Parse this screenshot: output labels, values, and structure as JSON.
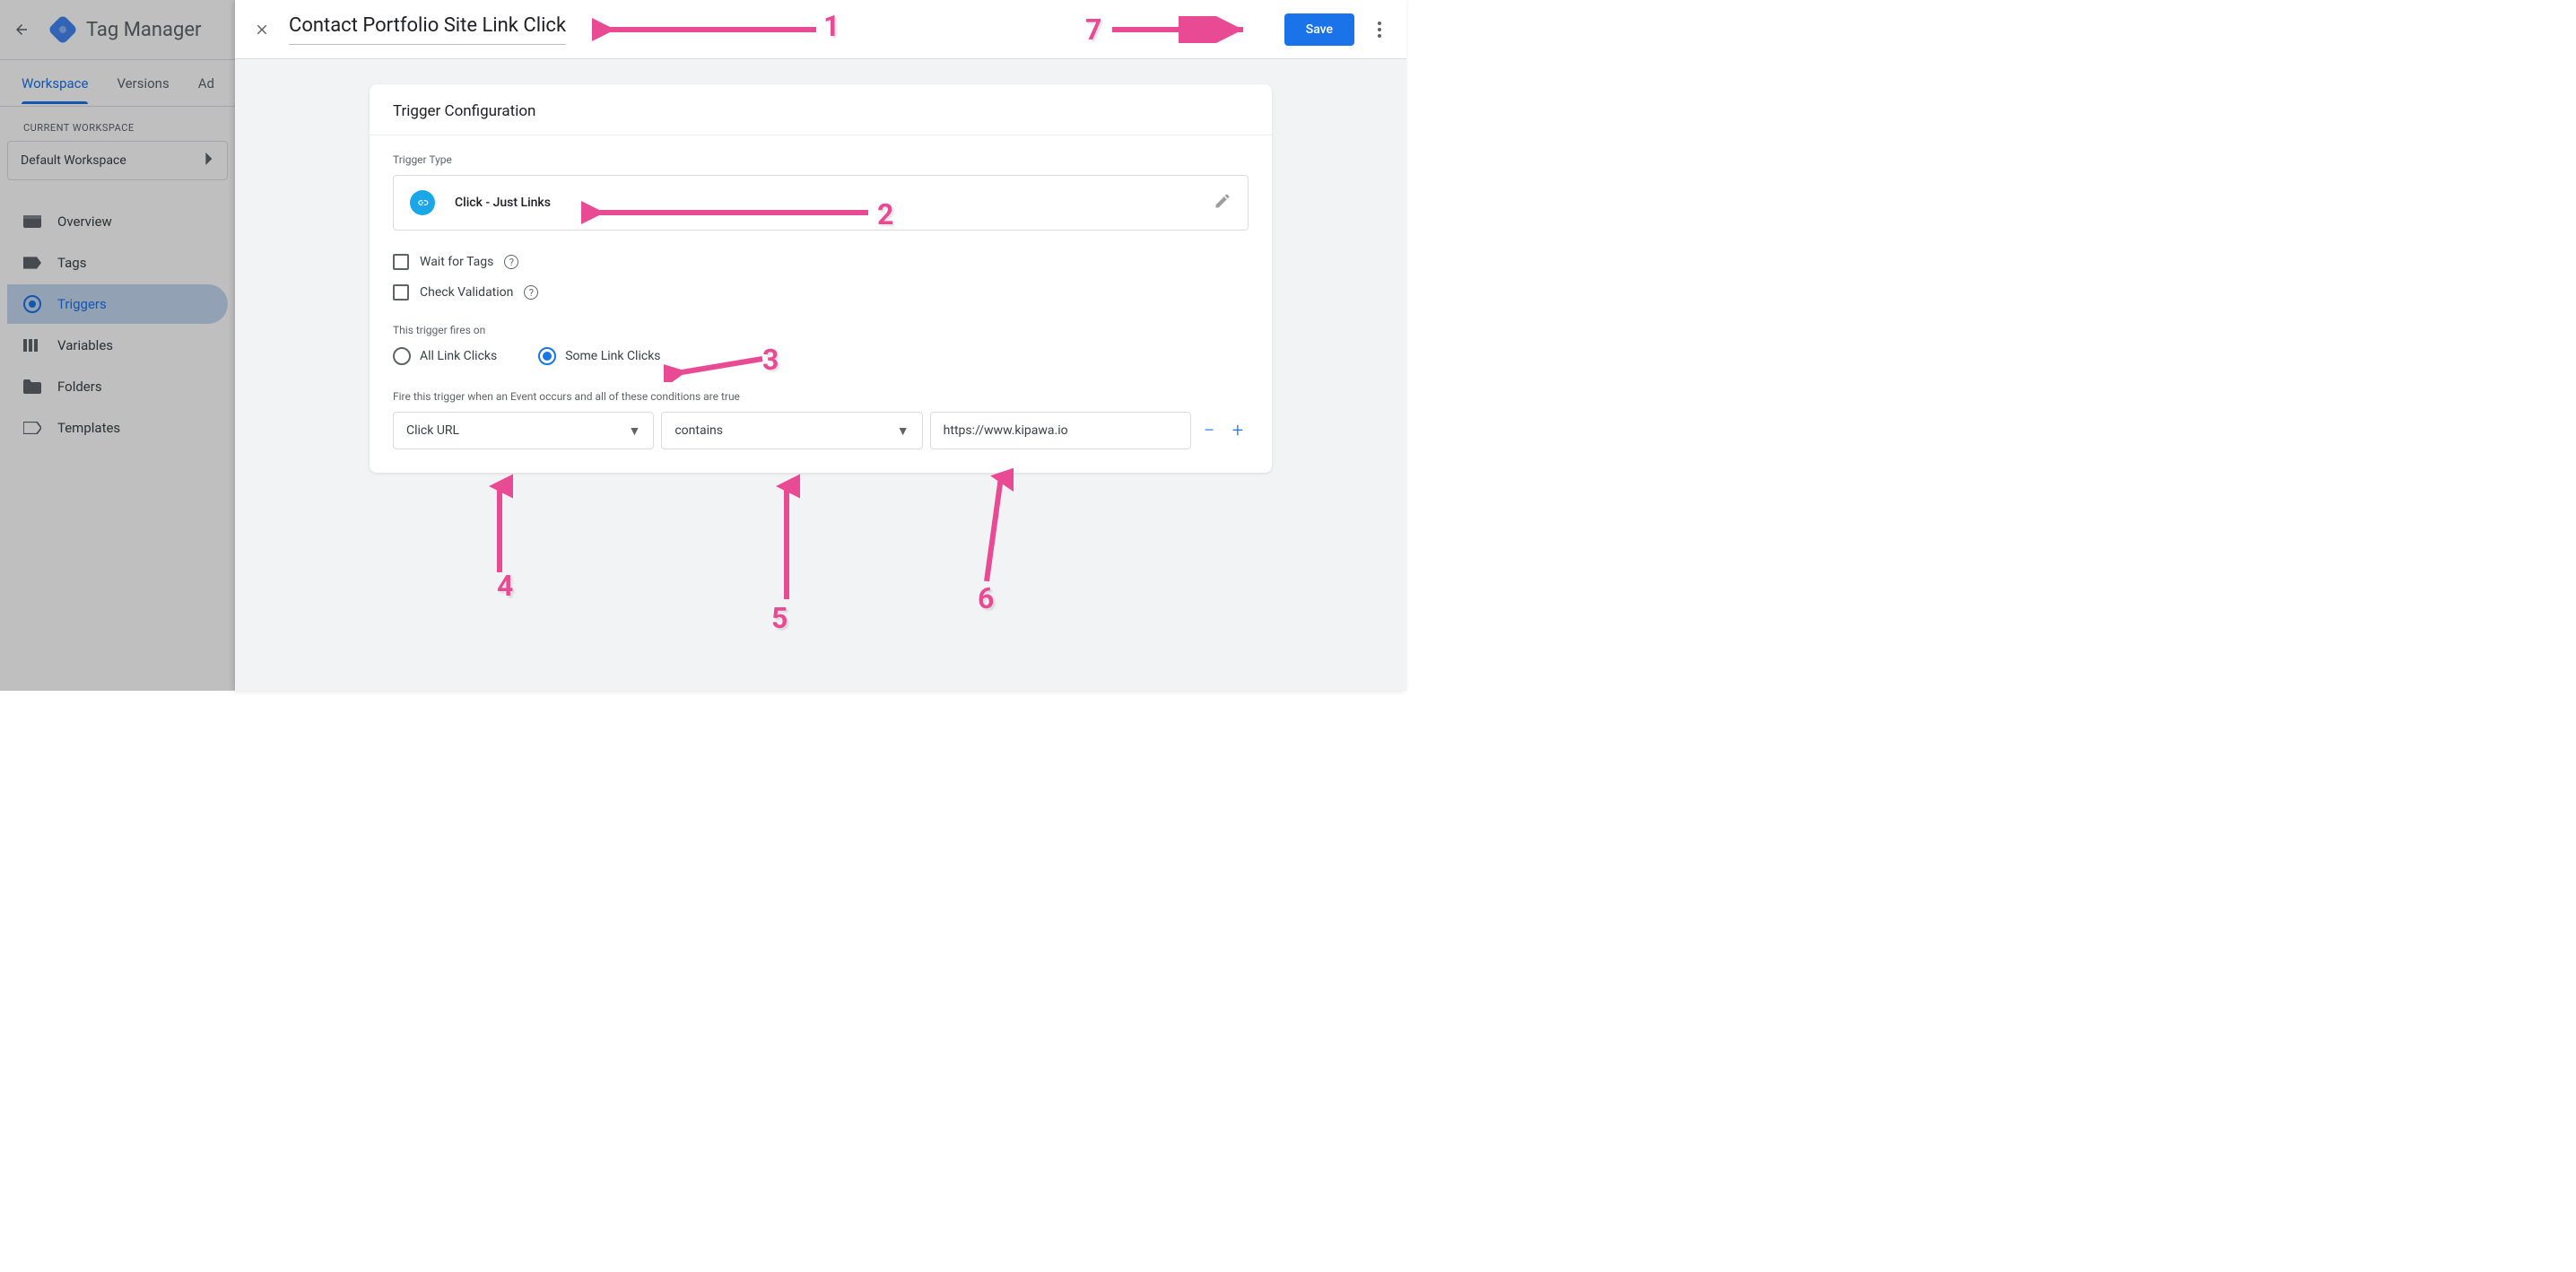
{
  "gtm": {
    "title": "Tag Manager",
    "tabs": {
      "workspace": "Workspace",
      "versions": "Versions",
      "admin": "Ad"
    },
    "currentWsLabel": "CURRENT WORKSPACE",
    "currentWs": "Default Workspace",
    "nav": {
      "overview": "Overview",
      "tags": "Tags",
      "triggers": "Triggers",
      "variables": "Variables",
      "folders": "Folders",
      "templates": "Templates"
    }
  },
  "panel": {
    "title": "Contact Portfolio Site Link Click",
    "saveLabel": "Save"
  },
  "card": {
    "heading": "Trigger Configuration",
    "triggerTypeLabel": "Trigger Type",
    "triggerType": "Click - Just Links",
    "waitForTags": "Wait for Tags",
    "checkValidation": "Check Validation",
    "firesLabel": "This trigger fires on",
    "allLinkClicks": "All Link Clicks",
    "someLinkClicks": "Some Link Clicks",
    "conditionLabel": "Fire this trigger when an Event occurs and all of these conditions are true",
    "condVar": "Click URL",
    "condOp": "contains",
    "condVal": "https://www.kipawa.io"
  },
  "annotations": {
    "n1": "1",
    "n2": "2",
    "n3": "3",
    "n4": "4",
    "n5": "5",
    "n6": "6",
    "n7": "7"
  }
}
